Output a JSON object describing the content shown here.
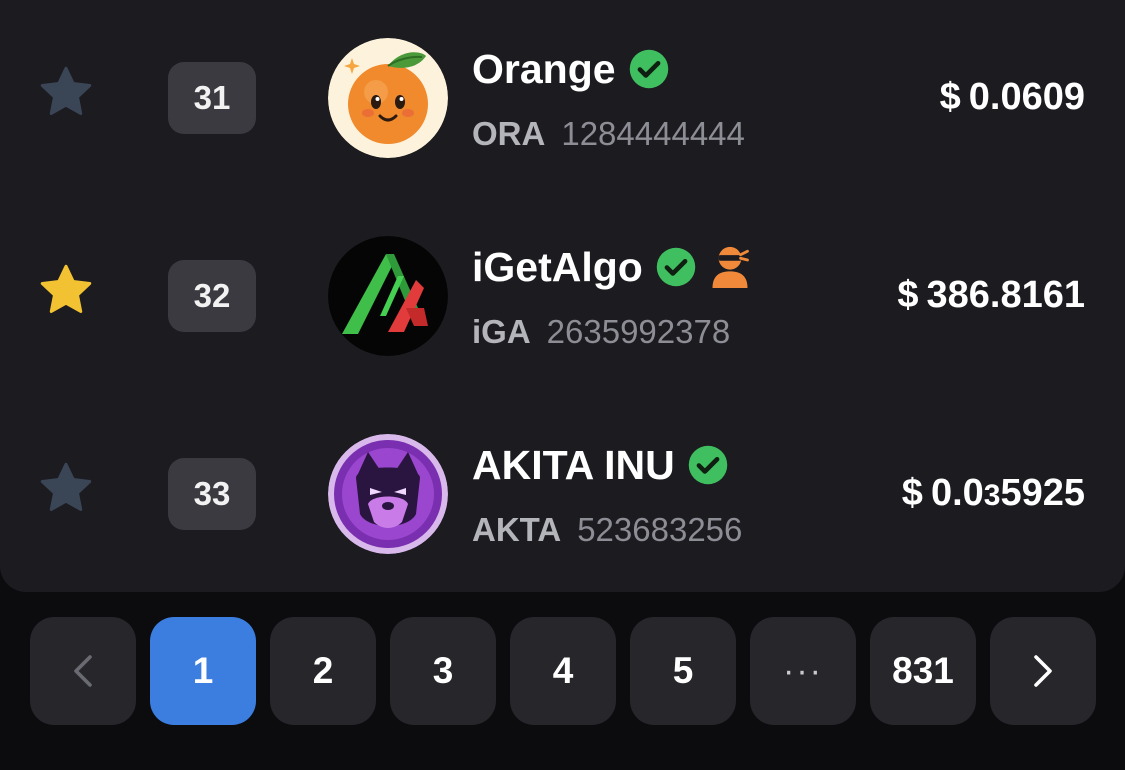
{
  "tokens": [
    {
      "rank": "31",
      "name": "Orange",
      "symbol": "ORA",
      "asset_id": "1284444444",
      "price_currency": "$",
      "price_main": "0.0609",
      "price_sub": "",
      "price_tail": "",
      "favorited": false,
      "verified": true,
      "avatar_icon": "orange-mascot-icon"
    },
    {
      "rank": "32",
      "name": "iGetAlgo",
      "symbol": "iGA",
      "asset_id": "2635992378",
      "price_currency": "$",
      "price_main": "386.8161",
      "price_sub": "",
      "price_tail": "",
      "favorited": true,
      "verified": true,
      "extra_badge_icon": "ninja-user-icon",
      "avatar_icon": "algo-logo-icon"
    },
    {
      "rank": "33",
      "name": "AKITA INU",
      "symbol": "AKTA",
      "asset_id": "523683256",
      "price_currency": "$",
      "price_main": "0.0",
      "price_sub": "3",
      "price_tail": "5925",
      "favorited": false,
      "verified": true,
      "avatar_icon": "akita-dog-icon"
    }
  ],
  "pagination": {
    "prev_icon": "chevron-left-icon",
    "next_icon": "chevron-right-icon",
    "pages": [
      "1",
      "2",
      "3",
      "4",
      "5"
    ],
    "ellipsis": "···",
    "last_page": "831",
    "current_page": "1"
  },
  "colors": {
    "background": "#0c0c0f",
    "card": "#1b1b20",
    "accent": "#3b7ee0",
    "star_active": "#f2c233",
    "star_inactive": "#3a4556",
    "verified": "#3fbf5f"
  }
}
